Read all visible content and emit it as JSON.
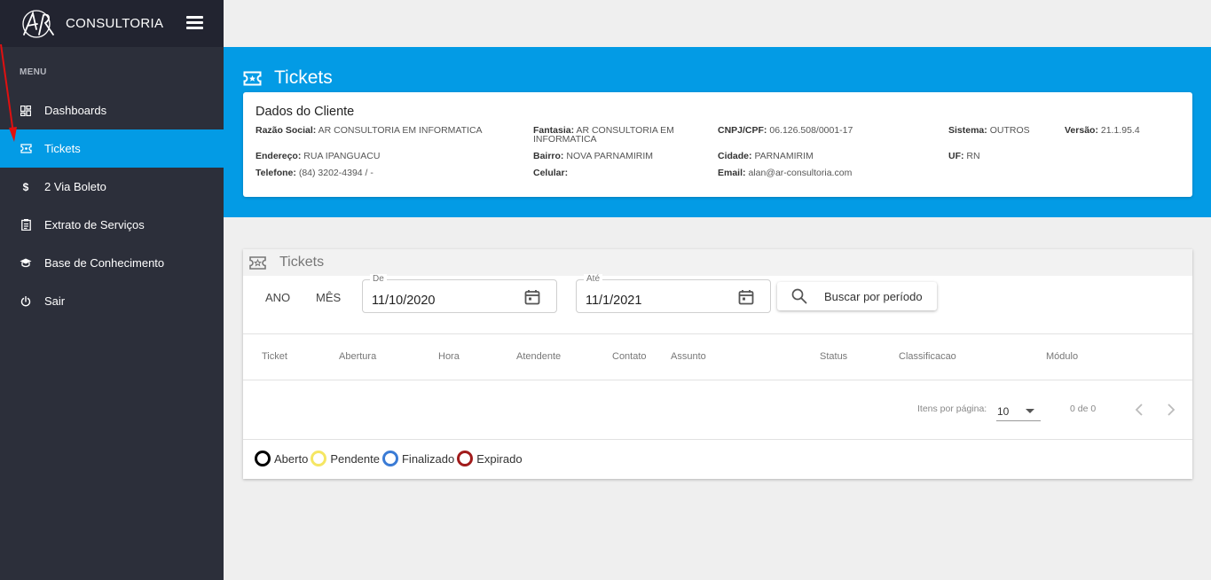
{
  "brand": {
    "name": "CONSULTORIA",
    "logo_text": "AR"
  },
  "sidebar": {
    "menu_header": "MENU",
    "items": [
      {
        "label": "Dashboards",
        "icon": "dashboard-icon"
      },
      {
        "label": "Tickets",
        "icon": "ticket-icon",
        "active": true
      },
      {
        "label": "2 Via Boleto",
        "icon": "dollar-icon"
      },
      {
        "label": "Extrato de Serviços",
        "icon": "clipboard-icon"
      },
      {
        "label": "Base de Conhecimento",
        "icon": "graduation-cap-icon"
      },
      {
        "label": "Sair",
        "icon": "power-icon"
      }
    ]
  },
  "header": {
    "title": "Tickets"
  },
  "client": {
    "title": "Dados do Cliente",
    "razao_label": "Razão Social:",
    "razao_value": "AR CONSULTORIA EM INFORMATICA",
    "fantasia_label": "Fantasia:",
    "fantasia_value": "AR CONSULTORIA EM",
    "fantasia_value2": "INFORMATICA",
    "cnpj_label": "CNPJ/CPF:",
    "cnpj_value": "06.126.508/0001-17",
    "sistema_label": "Sistema:",
    "sistema_value": "OUTROS",
    "versao_label": "Versão:",
    "versao_value": "21.1.95.4",
    "endereco_label": "Endereço:",
    "endereco_value": "RUA IPANGUACU",
    "bairro_label": "Bairro:",
    "bairro_value": "NOVA PARNAMIRIM",
    "cidade_label": "Cidade:",
    "cidade_value": "PARNAMIRIM",
    "uf_label": "UF:",
    "uf_value": "RN",
    "telefone_label": "Telefone:",
    "telefone_value": "(84) 3202-4394 / -",
    "celular_label": "Celular:",
    "celular_value": "",
    "email_label": "Email:",
    "email_value": "alan@ar-consultoria.com"
  },
  "tickets": {
    "title": "Tickets",
    "toggle_ano": "ANO",
    "toggle_mes": "MÊS",
    "de_label": "De",
    "de_value": "11/10/2020",
    "ate_label": "Até",
    "ate_value": "11/1/2021",
    "search_label": "Buscar por período",
    "columns": [
      "Ticket",
      "Abertura",
      "Hora",
      "Atendente",
      "Contato",
      "Assunto",
      "Status",
      "Classificacao",
      "Módulo"
    ],
    "items_per_page_label": "Itens por página:",
    "page_size": "10",
    "range_label": "0 de 0",
    "legend": [
      {
        "label": "Aberto",
        "color": "#000000"
      },
      {
        "label": "Pendente",
        "color": "#f5e663"
      },
      {
        "label": "Finalizado",
        "color": "#3a7bd5"
      },
      {
        "label": "Expirado",
        "color": "#a11b1b"
      }
    ]
  },
  "colors": {
    "accent": "#039be5",
    "sidebar_bg": "#2c2f3a",
    "brand_bg": "#222430"
  }
}
